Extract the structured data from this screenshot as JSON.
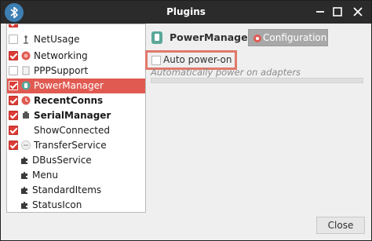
{
  "window": {
    "title": "Plugins"
  },
  "colors": {
    "accent": "#e15a52",
    "titlebar": "#2b2b2b",
    "highlight_border": "#e07a6c"
  },
  "plugins": [
    {
      "label": "NetUsage",
      "checked": false,
      "bold": false,
      "icon": "wrench-icon"
    },
    {
      "label": "Networking",
      "checked": true,
      "bold": false,
      "icon": "globe-icon"
    },
    {
      "label": "PPPSupport",
      "checked": false,
      "bold": false,
      "icon": "document-icon"
    },
    {
      "label": "PowerManager",
      "checked": true,
      "bold": false,
      "icon": "power-icon",
      "selected": true
    },
    {
      "label": "RecentConns",
      "checked": true,
      "bold": true,
      "icon": "recent-icon"
    },
    {
      "label": "SerialManager",
      "checked": true,
      "bold": true,
      "icon": "serial-icon"
    },
    {
      "label": "ShowConnected",
      "checked": true,
      "bold": false,
      "icon": "blank-icon"
    },
    {
      "label": "TransferService",
      "checked": true,
      "bold": false,
      "icon": "transfer-icon"
    },
    {
      "label": "DBusService",
      "checked": null,
      "bold": false,
      "icon": "puzzle-icon"
    },
    {
      "label": "Menu",
      "checked": null,
      "bold": false,
      "icon": "puzzle-icon"
    },
    {
      "label": "StandardItems",
      "checked": null,
      "bold": false,
      "icon": "puzzle-icon"
    },
    {
      "label": "StatusIcon",
      "checked": null,
      "bold": false,
      "icon": "puzzle-icon"
    }
  ],
  "details": {
    "plugin_name": "PowerManager",
    "configuration_label": "Configuration",
    "option_label": "Auto power-on",
    "option_checked": false,
    "option_description": "Automatically power on adapters"
  },
  "buttons": {
    "close_label": "Close"
  }
}
